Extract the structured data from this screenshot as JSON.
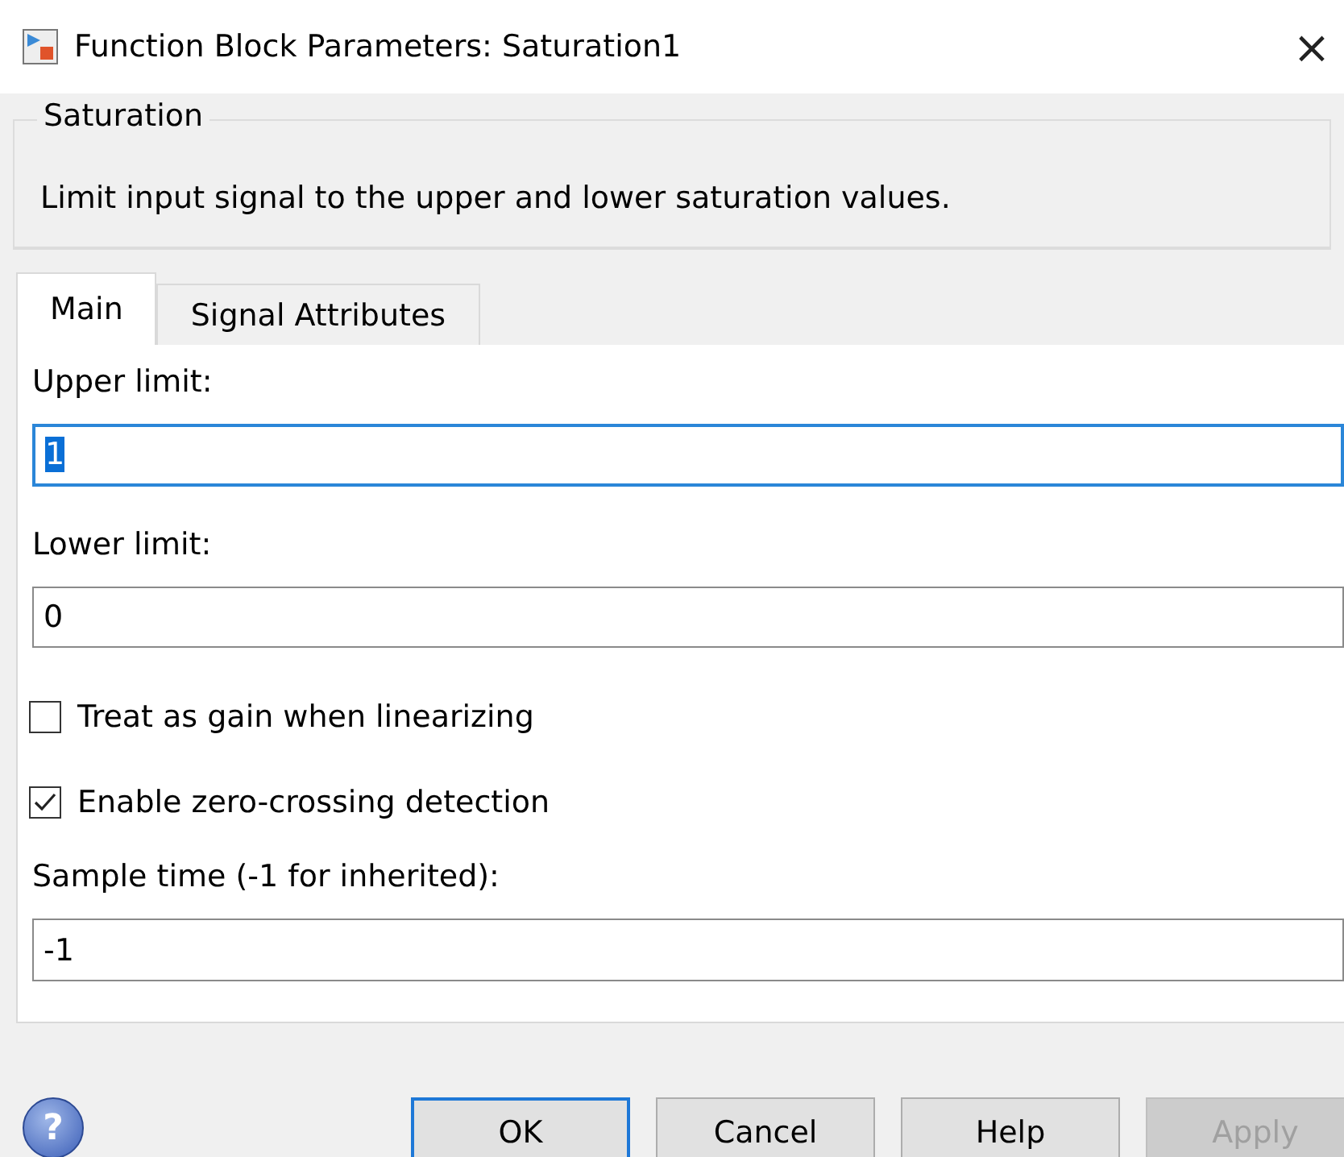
{
  "window": {
    "title": "Function Block Parameters: Saturation1",
    "close": "×"
  },
  "group": {
    "title": "Saturation",
    "description": "Limit input signal to the upper and lower saturation values."
  },
  "tabs": [
    {
      "label": "Main",
      "selected": true
    },
    {
      "label": "Signal Attributes",
      "selected": false
    }
  ],
  "parameters": [
    {
      "kind": "field",
      "label": "Upper limit:",
      "value": "1",
      "focused": true
    },
    {
      "kind": "field",
      "label": "Lower limit:",
      "value": "0",
      "focused": false
    },
    {
      "kind": "checkbox",
      "label": "Treat as gain when linearizing",
      "checked": false
    },
    {
      "kind": "checkbox",
      "label": "Enable zero-crossing detection",
      "checked": true
    },
    {
      "kind": "field",
      "label": "Sample time (-1 for inherited):",
      "value": "-1",
      "focused": false
    }
  ],
  "help": "?",
  "buttons": [
    {
      "label": "OK",
      "default": true,
      "disabled": false
    },
    {
      "label": "Cancel",
      "default": false,
      "disabled": false
    },
    {
      "label": "Help",
      "default": false,
      "disabled": false
    },
    {
      "label": "Apply",
      "default": false,
      "disabled": true
    }
  ]
}
